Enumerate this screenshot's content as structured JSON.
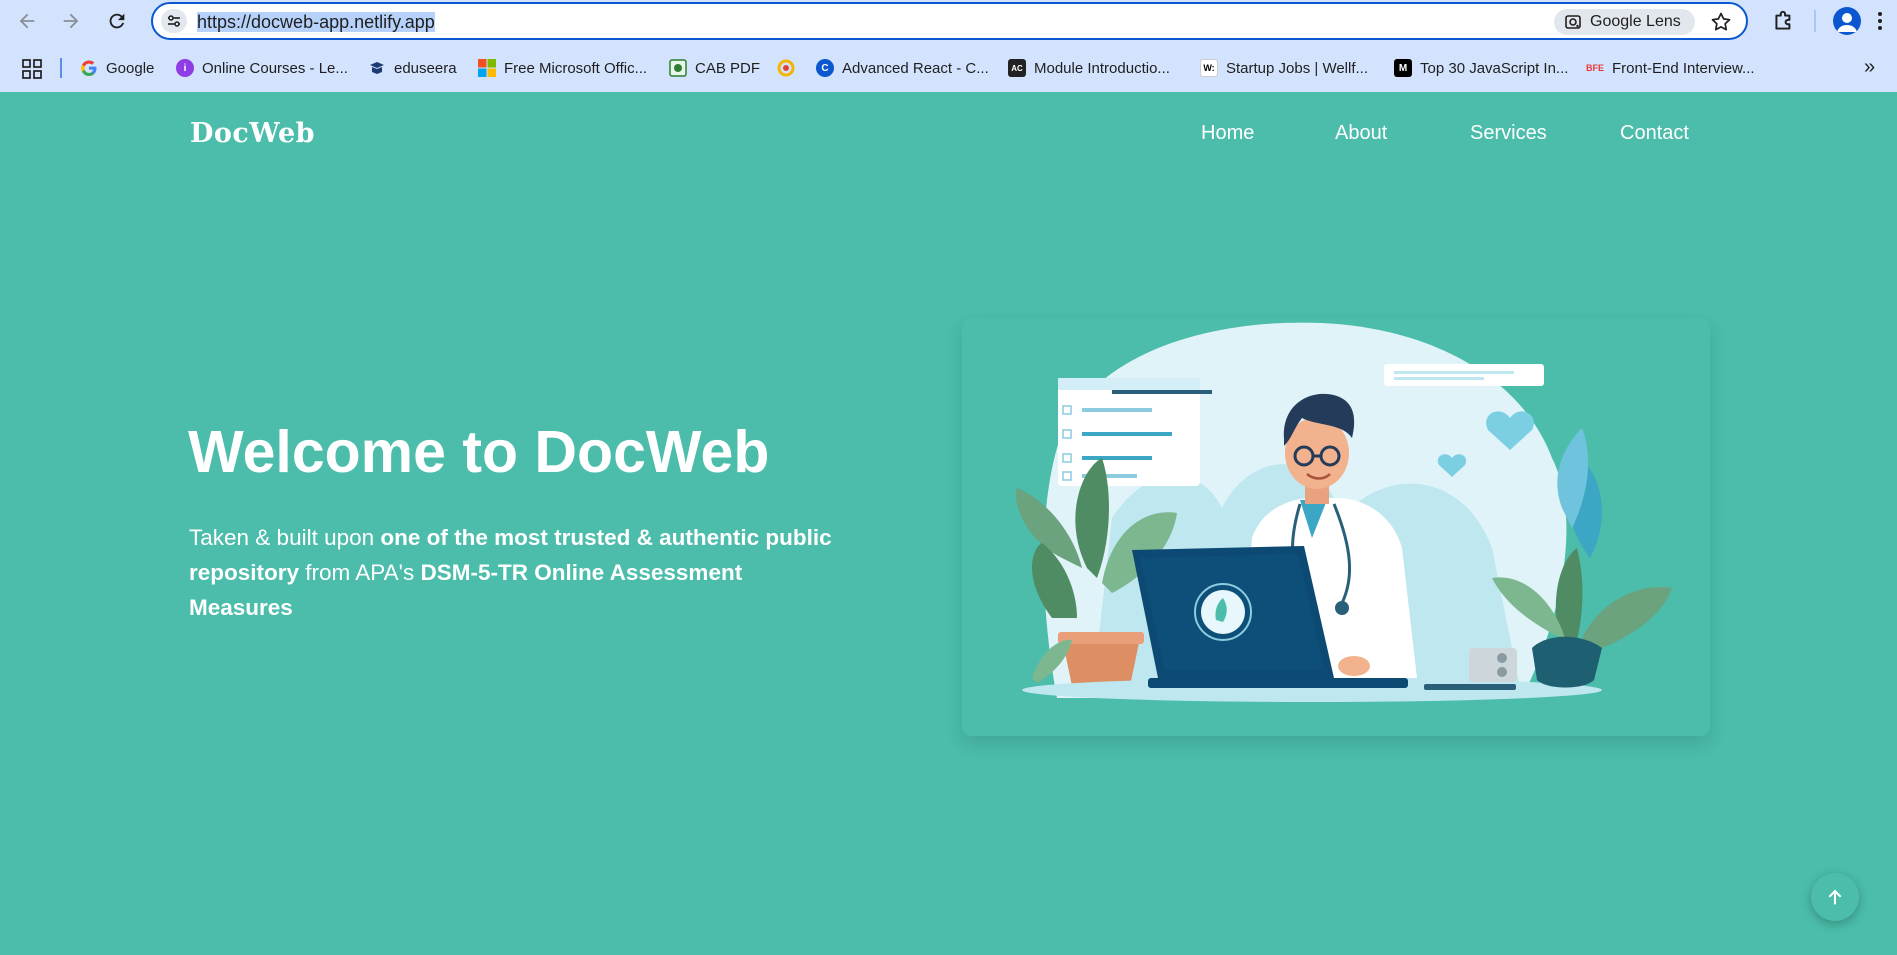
{
  "browser": {
    "url_prefix": "https://",
    "url_host": "docweb-app.netlify.app",
    "lens_label": "Google Lens",
    "bookmarks": [
      {
        "label": "Google",
        "icon": "google-icon",
        "color": "#ffffff"
      },
      {
        "label": "Online Courses - Le...",
        "icon": "online-courses-icon",
        "color": "#8e3ce6"
      },
      {
        "label": "eduseera",
        "icon": "eduseera-icon",
        "color": "#1e3a73"
      },
      {
        "label": "Free Microsoft Offic...",
        "icon": "microsoft-icon",
        "color": "#f25022"
      },
      {
        "label": "CAB PDF",
        "icon": "cab-pdf-icon",
        "color": "#2e7d32"
      },
      {
        "label": "",
        "icon": "chrome-ring-icon",
        "color": "#f4b400"
      },
      {
        "label": "Advanced React - C...",
        "icon": "advanced-react-icon",
        "color": "#0b57d0"
      },
      {
        "label": "Module Introductio...",
        "icon": "module-icon",
        "color": "#222222"
      },
      {
        "label": "Startup Jobs | Wellf...",
        "icon": "wellfound-icon",
        "color": "#ffffff"
      },
      {
        "label": "Top 30 JavaScript In...",
        "icon": "medium-icon",
        "color": "#000000"
      },
      {
        "label": "Front-End Interview...",
        "icon": "bfe-icon",
        "color": "#ffffff"
      }
    ]
  },
  "site": {
    "logo": "DocWeb",
    "nav": [
      "Home",
      "About",
      "Services",
      "Contact"
    ],
    "hero_title": "Welcome to DocWeb",
    "hero_sub": {
      "p1": "Taken & built upon ",
      "b1": "one of the most trusted & authentic public repository",
      "p2": " from APA's ",
      "b2": "DSM-5-TR Online Assessment Measures"
    },
    "illustration": "doctor-at-laptop-illustration"
  },
  "colors": {
    "page_bg": "#4bbdaa",
    "chrome_bg": "#d3e3fd",
    "accent": "#0b57d0"
  }
}
